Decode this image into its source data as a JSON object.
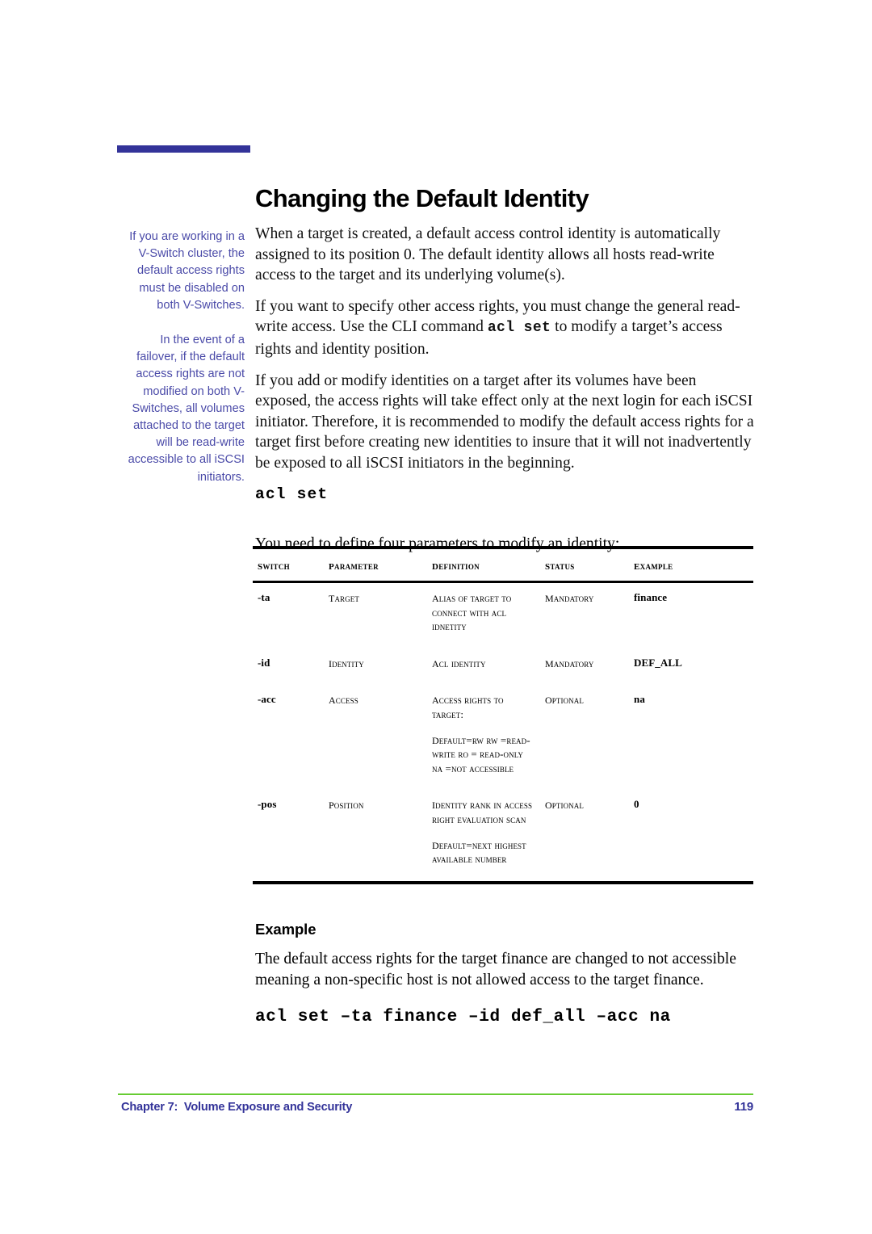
{
  "colors": {
    "title_rule": "#333399",
    "sidenote_text": "#4a4aa8",
    "footer_rule": "#66cc33",
    "footer_text": "#333399",
    "body_text": "#111111"
  },
  "title": "Changing the Default Identity",
  "sidenotes": [
    "If you are working in a V-Switch cluster, the default access rights must be disabled on both V-Switches.",
    "In the event of a failover, if the default access rights are not modified on both V-Switches, all volumes attached to the target will be read-write accessible to all iSCSI initiators."
  ],
  "body": {
    "paragraph_1": "When a target is created, a default access control identity is automatically assigned to its position 0.  The default identity allows all hosts read-write access to the target and its underlying volume(s).",
    "paragraph_2_part_1": "If you want to specify other access rights, you must change the general read-write access.  Use the CLI command ",
    "paragraph_2_command": "acl set",
    "paragraph_2_part_2": " to modify a target’s access rights and identity position.",
    "paragraph_3": "If you add or modify identities on a target after its volumes have been exposed, the access rights will take effect only at the next login for each iSCSI initiator.  Therefore, it is recommended to modify the default access rights for a target first before creating new identities to insure that it will not inadvertently be exposed to all iSCSI initiators in the beginning.",
    "command_heading": "acl set",
    "table_lead_in": "You need to define four parameters to modify an identity:"
  },
  "table": {
    "headers": [
      "Switch",
      "Parameter",
      "Definition",
      "Status",
      "Example"
    ],
    "rows": [
      {
        "switch": "-ta",
        "parameter": "Target",
        "definition_blocks": [
          "Alias of target to connect with ACL idnetity"
        ],
        "status": "Mandatory",
        "example": "finance"
      },
      {
        "switch": "-id",
        "parameter": "Identity",
        "definition_blocks": [
          "ACL identity"
        ],
        "status": "Mandatory",
        "example": "DEF_ALL"
      },
      {
        "switch": "-acc",
        "parameter": "Access",
        "definition_blocks": [
          "Access rights to target:",
          "Default=RW RW =read-write RO = read-only NA =not accessible"
        ],
        "status": "Optional",
        "example": "na"
      },
      {
        "switch": "-pos",
        "parameter": "Position",
        "definition_blocks": [
          "Identity rank in access right evaluation scan",
          "Default=next highest available number"
        ],
        "status": "Optional",
        "example": "0"
      }
    ]
  },
  "example_section": {
    "heading": "Example",
    "body": "The default access rights for the target finance are changed to not accessible meaning a non-specific host is not allowed access to the target finance.",
    "command": "acl set –ta finance –id def_all –acc na"
  },
  "footer": {
    "chapter": "Chapter 7:  Volume Exposure and Security",
    "page_number": "119"
  }
}
